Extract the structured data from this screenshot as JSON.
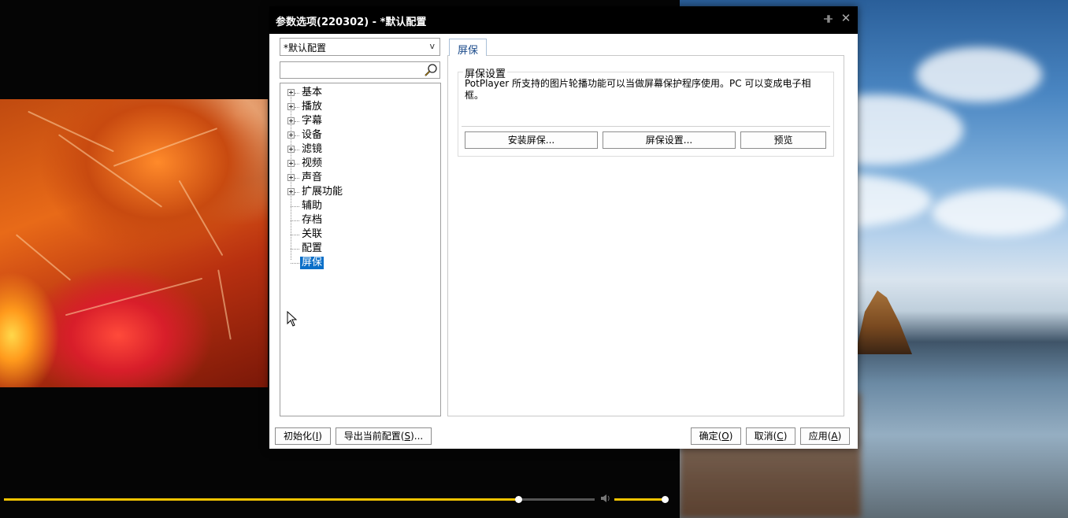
{
  "dialog": {
    "title": "参数选项(220302) - *默认配置",
    "profile_selected": "*默认配置",
    "profile_caret": "v",
    "search": {
      "value": "",
      "placeholder": ""
    },
    "tree": [
      {
        "label": "基本",
        "expandable": true
      },
      {
        "label": "播放",
        "expandable": true
      },
      {
        "label": "字幕",
        "expandable": true
      },
      {
        "label": "设备",
        "expandable": true
      },
      {
        "label": "滤镜",
        "expandable": true
      },
      {
        "label": "视频",
        "expandable": true
      },
      {
        "label": "声音",
        "expandable": true
      },
      {
        "label": "扩展功能",
        "expandable": true
      },
      {
        "label": "辅助",
        "expandable": false
      },
      {
        "label": "存档",
        "expandable": false
      },
      {
        "label": "关联",
        "expandable": false
      },
      {
        "label": "配置",
        "expandable": false
      },
      {
        "label": "屏保",
        "expandable": false,
        "selected": true
      }
    ],
    "tab_label": "屏保",
    "group": {
      "title": "屏保设置",
      "description": "PotPlayer 所支持的图片轮播功能可以当做屏幕保护程序使用。PC 可以变成电子相框。",
      "buttons": {
        "install": "安装屏保...",
        "settings": "屏保设置...",
        "preview": "预览"
      }
    },
    "footer": {
      "init": {
        "text": "初始化(",
        "key": "I",
        "end": ")"
      },
      "export": {
        "text": "导出当前配置(",
        "key": "S",
        "end": ")..."
      },
      "ok": {
        "text": "确定(",
        "key": "O",
        "end": ")"
      },
      "cancel": {
        "text": "取消(",
        "key": "C",
        "end": ")"
      },
      "apply": {
        "text": "应用(",
        "key": "A",
        "end": ")"
      }
    }
  },
  "player": {
    "seek_progress": 0.87,
    "volume_level": 1.0
  },
  "icons": {
    "pin": "pin-icon",
    "close": "close-icon",
    "search": "search-icon",
    "volume": "volume-icon"
  }
}
